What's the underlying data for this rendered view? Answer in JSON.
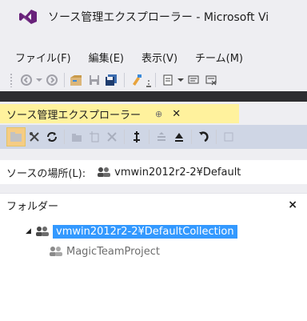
{
  "window": {
    "title": "ソース管理エクスプローラー - Microsoft Vi"
  },
  "menu": {
    "items": [
      "ファイル(F)",
      "編集(E)",
      "表示(V)",
      "チーム(M)"
    ]
  },
  "document_tab": {
    "label": "ソース管理エクスプローラー",
    "pin_glyph": "⊕",
    "close_glyph": "✕"
  },
  "source_location": {
    "label": "ソースの場所(L):",
    "value": "vmwin2012r2-2¥Default"
  },
  "folders": {
    "header": "フォルダー",
    "close_glyph": "×",
    "root": "vmwin2012r2-2¥DefaultCollection",
    "child": "MagicTeamProject"
  },
  "colors": {
    "tab_active": "#fff29d",
    "selection": "#3399ff",
    "vs_purple": "#68217a"
  }
}
